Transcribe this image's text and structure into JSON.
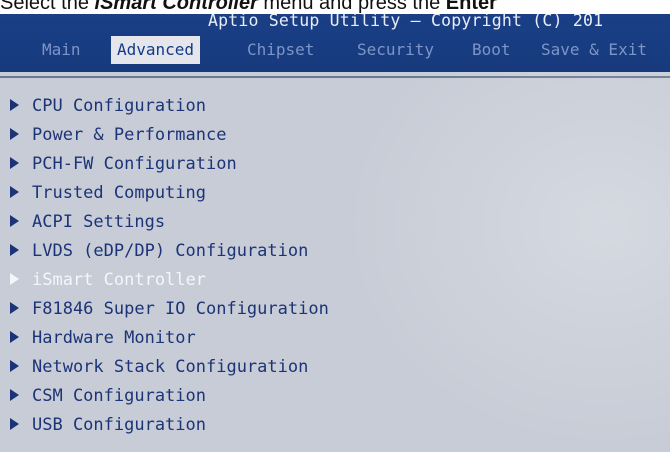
{
  "caption": {
    "prefix": "Select the ",
    "emphasis": "iSmart Controller",
    "middle": " menu and press the ",
    "key": "Enter"
  },
  "title": "Aptio Setup Utility – Copyright (C) 201",
  "tabs": [
    {
      "label": "Main",
      "active": false
    },
    {
      "label": "Advanced",
      "active": true
    },
    {
      "label": "Chipset",
      "active": false
    },
    {
      "label": "Security",
      "active": false
    },
    {
      "label": "Boot",
      "active": false
    },
    {
      "label": "Save & Exit",
      "active": false
    }
  ],
  "menu_items": [
    {
      "label": "CPU Configuration"
    },
    {
      "label": "Power & Performance"
    },
    {
      "label": "PCH-FW Configuration"
    },
    {
      "label": "Trusted Computing"
    },
    {
      "label": "ACPI Settings"
    },
    {
      "label": "LVDS (eDP/DP) Configuration"
    },
    {
      "label": "iSmart Controller",
      "selected": true
    },
    {
      "label": "F81846 Super IO Configuration"
    },
    {
      "label": "Hardware Monitor"
    },
    {
      "label": "Network Stack Configuration"
    },
    {
      "label": "CSM Configuration"
    },
    {
      "label": "USB Configuration"
    }
  ],
  "colors": {
    "header_bg": "#1a3f86",
    "body_bg": "#c7ccd6",
    "menu_text": "#1c3477",
    "selected_text": "#f4f6fb"
  }
}
